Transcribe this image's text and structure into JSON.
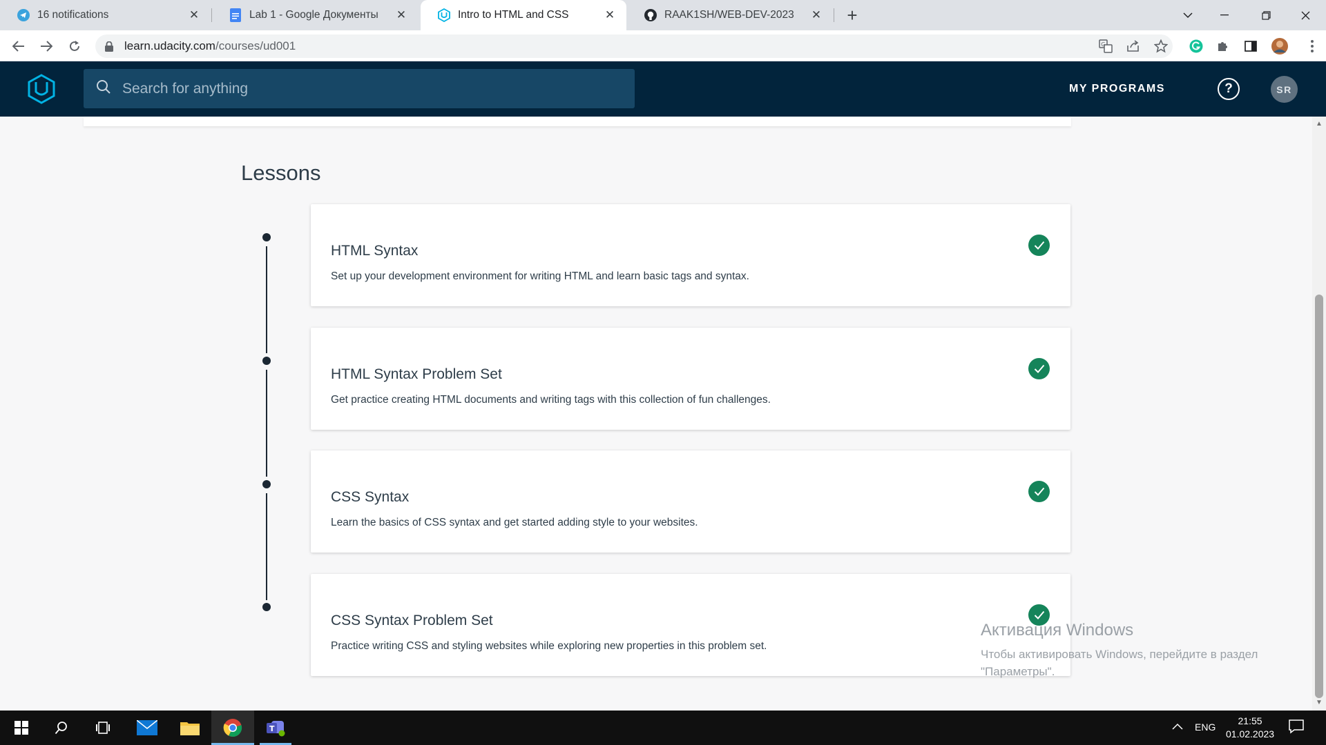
{
  "browser": {
    "tabs": [
      {
        "title": "16 notifications",
        "icon": "telegram-icon",
        "active": false
      },
      {
        "title": "Lab 1 - Google Документы",
        "icon": "google-docs-icon",
        "active": false
      },
      {
        "title": "Intro to HTML and CSS",
        "icon": "udacity-icon",
        "active": true
      },
      {
        "title": "RAAK1SH/WEB-DEV-2023",
        "icon": "github-icon",
        "active": false
      }
    ],
    "url_host": "learn.udacity.com",
    "url_path": "/courses/ud001"
  },
  "header": {
    "search_placeholder": "Search for anything",
    "my_programs": "MY PROGRAMS",
    "help_glyph": "?",
    "avatar_initials": "SR"
  },
  "lessons": {
    "title": "Lessons",
    "items": [
      {
        "title": "HTML Syntax",
        "description": "Set up your development environment for writing HTML and learn basic tags and syntax.",
        "completed": true
      },
      {
        "title": "HTML Syntax Problem Set",
        "description": "Get practice creating HTML documents and writing tags with this collection of fun challenges.",
        "completed": true
      },
      {
        "title": "CSS Syntax",
        "description": "Learn the basics of CSS syntax and get started adding style to your websites.",
        "completed": true
      },
      {
        "title": "CSS Syntax Problem Set",
        "description": "Practice writing CSS and styling websites while exploring new properties in this problem set.",
        "completed": true
      }
    ]
  },
  "watermark": {
    "line1": "Активация Windows",
    "line2": "Чтобы активировать Windows, перейдите в раздел",
    "line3": "\"Параметры\"."
  },
  "taskbar": {
    "lang": "ENG",
    "time": "21:55",
    "date": "01.02.2023"
  },
  "colors": {
    "header_bg": "#02243c",
    "search_bg": "#174766",
    "brand_accent": "#02b3e4",
    "check_green": "#15845a"
  }
}
